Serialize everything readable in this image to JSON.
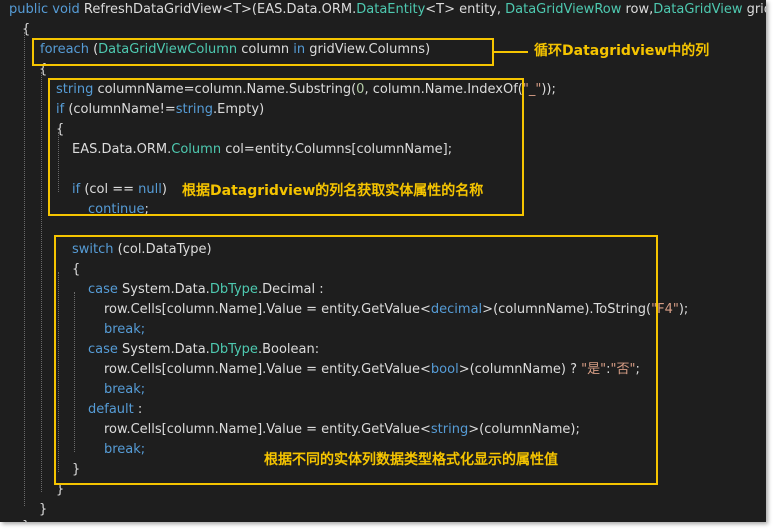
{
  "code": {
    "signature": {
      "kw1": "public",
      "kw2": "void",
      "name": "RefreshDataGridView<T>(EAS.Data.ORM.",
      "type1": "DataEntity",
      "mid1": "<T> entity, ",
      "type2": "DataGridViewRow",
      "mid2": " row,",
      "type3": "DataGridView",
      "end": " gridView)"
    },
    "open_brace": "{",
    "foreach_line": {
      "kw": "foreach",
      "p1": " (",
      "type": "DataGridViewColumn",
      "p2": " column ",
      "kw2": "in",
      "p3": " gridView.Columns)"
    },
    "foreach_open": "{",
    "string_line": {
      "kw": "string",
      "p1": " columnName=column.Name.Substring(",
      "num": "0",
      "p2": ", column.Name.IndexOf(",
      "str": "\"_\"",
      "p3": "));"
    },
    "if_line": {
      "kw": "if",
      "p1": " (columnName!=",
      "kw2": "string",
      "p2": ".Empty)"
    },
    "if_open": "{",
    "col_line": {
      "p1": "EAS.Data.ORM.",
      "type": "Column",
      "p2": " col=entity.Columns[columnName];"
    },
    "ifnull_line": {
      "kw": "if",
      "p1": " (col == ",
      "kw2": "null",
      "p2": ")"
    },
    "continue_line": {
      "kw": "continue",
      "p1": ";"
    },
    "switch_line": {
      "kw": "switch",
      "p1": " (col.DataType)"
    },
    "switch_open": "{",
    "case1_line": {
      "kw": "case",
      "p1": " System.Data.",
      "type": "DbType",
      "p2": ".Decimal :"
    },
    "row1_line": {
      "p1": "row.Cells[column.Name].Value = entity.GetValue<",
      "kw": "decimal",
      "p2": ">(columnName).ToString(",
      "str": "\"F4\"",
      "p3": ");"
    },
    "break1": "break;",
    "case2_line": {
      "kw": "case",
      "p1": " System.Data.",
      "type": "DbType",
      "p2": ".Boolean:"
    },
    "row2_line": {
      "p1": "row.Cells[column.Name].Value = entity.GetValue<",
      "kw": "bool",
      "p2": ">(columnName) ? ",
      "str1": "\"是\"",
      "p3": ":",
      "str2": "\"否\"",
      "p4": ";"
    },
    "break2": "break;",
    "default_line": {
      "kw": "default",
      "p1": " :"
    },
    "row3_line": {
      "p1": "row.Cells[column.Name].Value = entity.GetValue<",
      "kw": "string",
      "p2": ">(columnName);"
    },
    "break3": "break;",
    "switch_close": "}",
    "if_close": "}",
    "foreach_close": "}",
    "method_close": "}"
  },
  "annotations": {
    "loop": "循环Datagridview中的列",
    "name": "根据Datagridview的列名获取实体属性的名称",
    "format": "根据不同的实体列数据类型格式化显示的属性值"
  },
  "colors": {
    "background": "#1e1e1e",
    "plain_text": "#dcdcdc",
    "keyword": "#569cd6",
    "type": "#4ec9b0",
    "string": "#d69d85",
    "number": "#b5cea8",
    "highlight": "#f5c400"
  }
}
